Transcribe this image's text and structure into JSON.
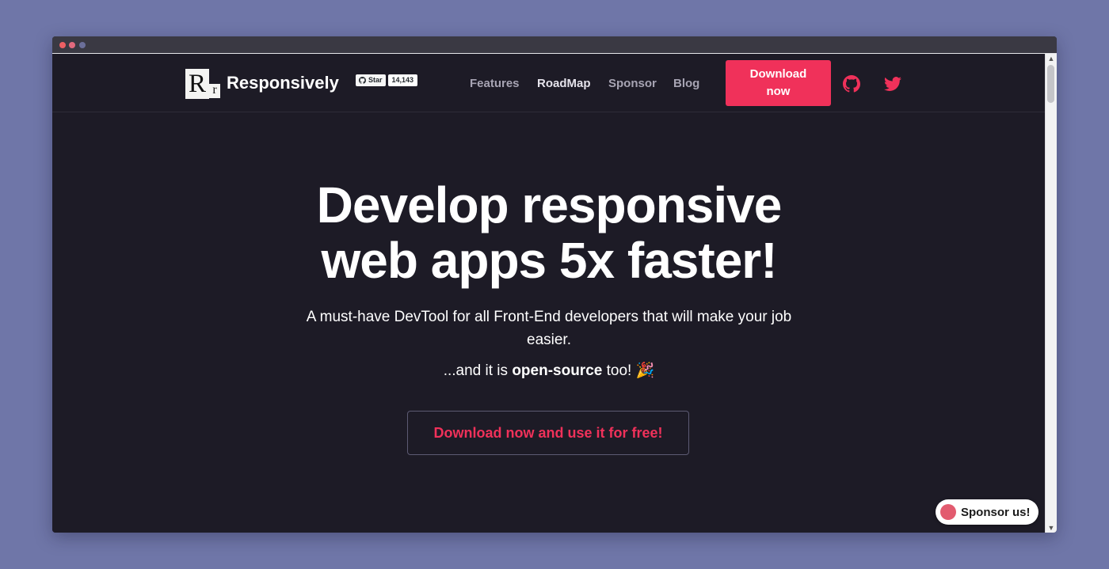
{
  "nav": {
    "brand": "Responsively",
    "logo_big": "R",
    "logo_small": "r",
    "github_star": {
      "label": "Star",
      "count": "14,143"
    },
    "links": [
      {
        "label": "Features",
        "active": false
      },
      {
        "label": "RoadMap",
        "active": true
      },
      {
        "label": "Sponsor",
        "active": false
      },
      {
        "label": "Blog",
        "active": false
      }
    ],
    "download": {
      "line1": "Download",
      "line2": "now"
    },
    "icons": [
      "github-icon",
      "twitter-icon"
    ]
  },
  "hero": {
    "title_line1": "Develop responsive",
    "title_line2": "web apps 5x faster!",
    "subtitle": "A must-have DevTool for all Front-End developers that will make your job easier.",
    "oss_prefix": "...and it is ",
    "oss_strong": "open-source",
    "oss_suffix": " too!",
    "oss_emoji": "🎉",
    "cta": "Download now and use it for free!"
  },
  "sponsor_badge": {
    "label": "Sponsor us!"
  },
  "colors": {
    "accent": "#f0315a",
    "background": "#1d1b26",
    "page_bg": "#6f76a8"
  }
}
